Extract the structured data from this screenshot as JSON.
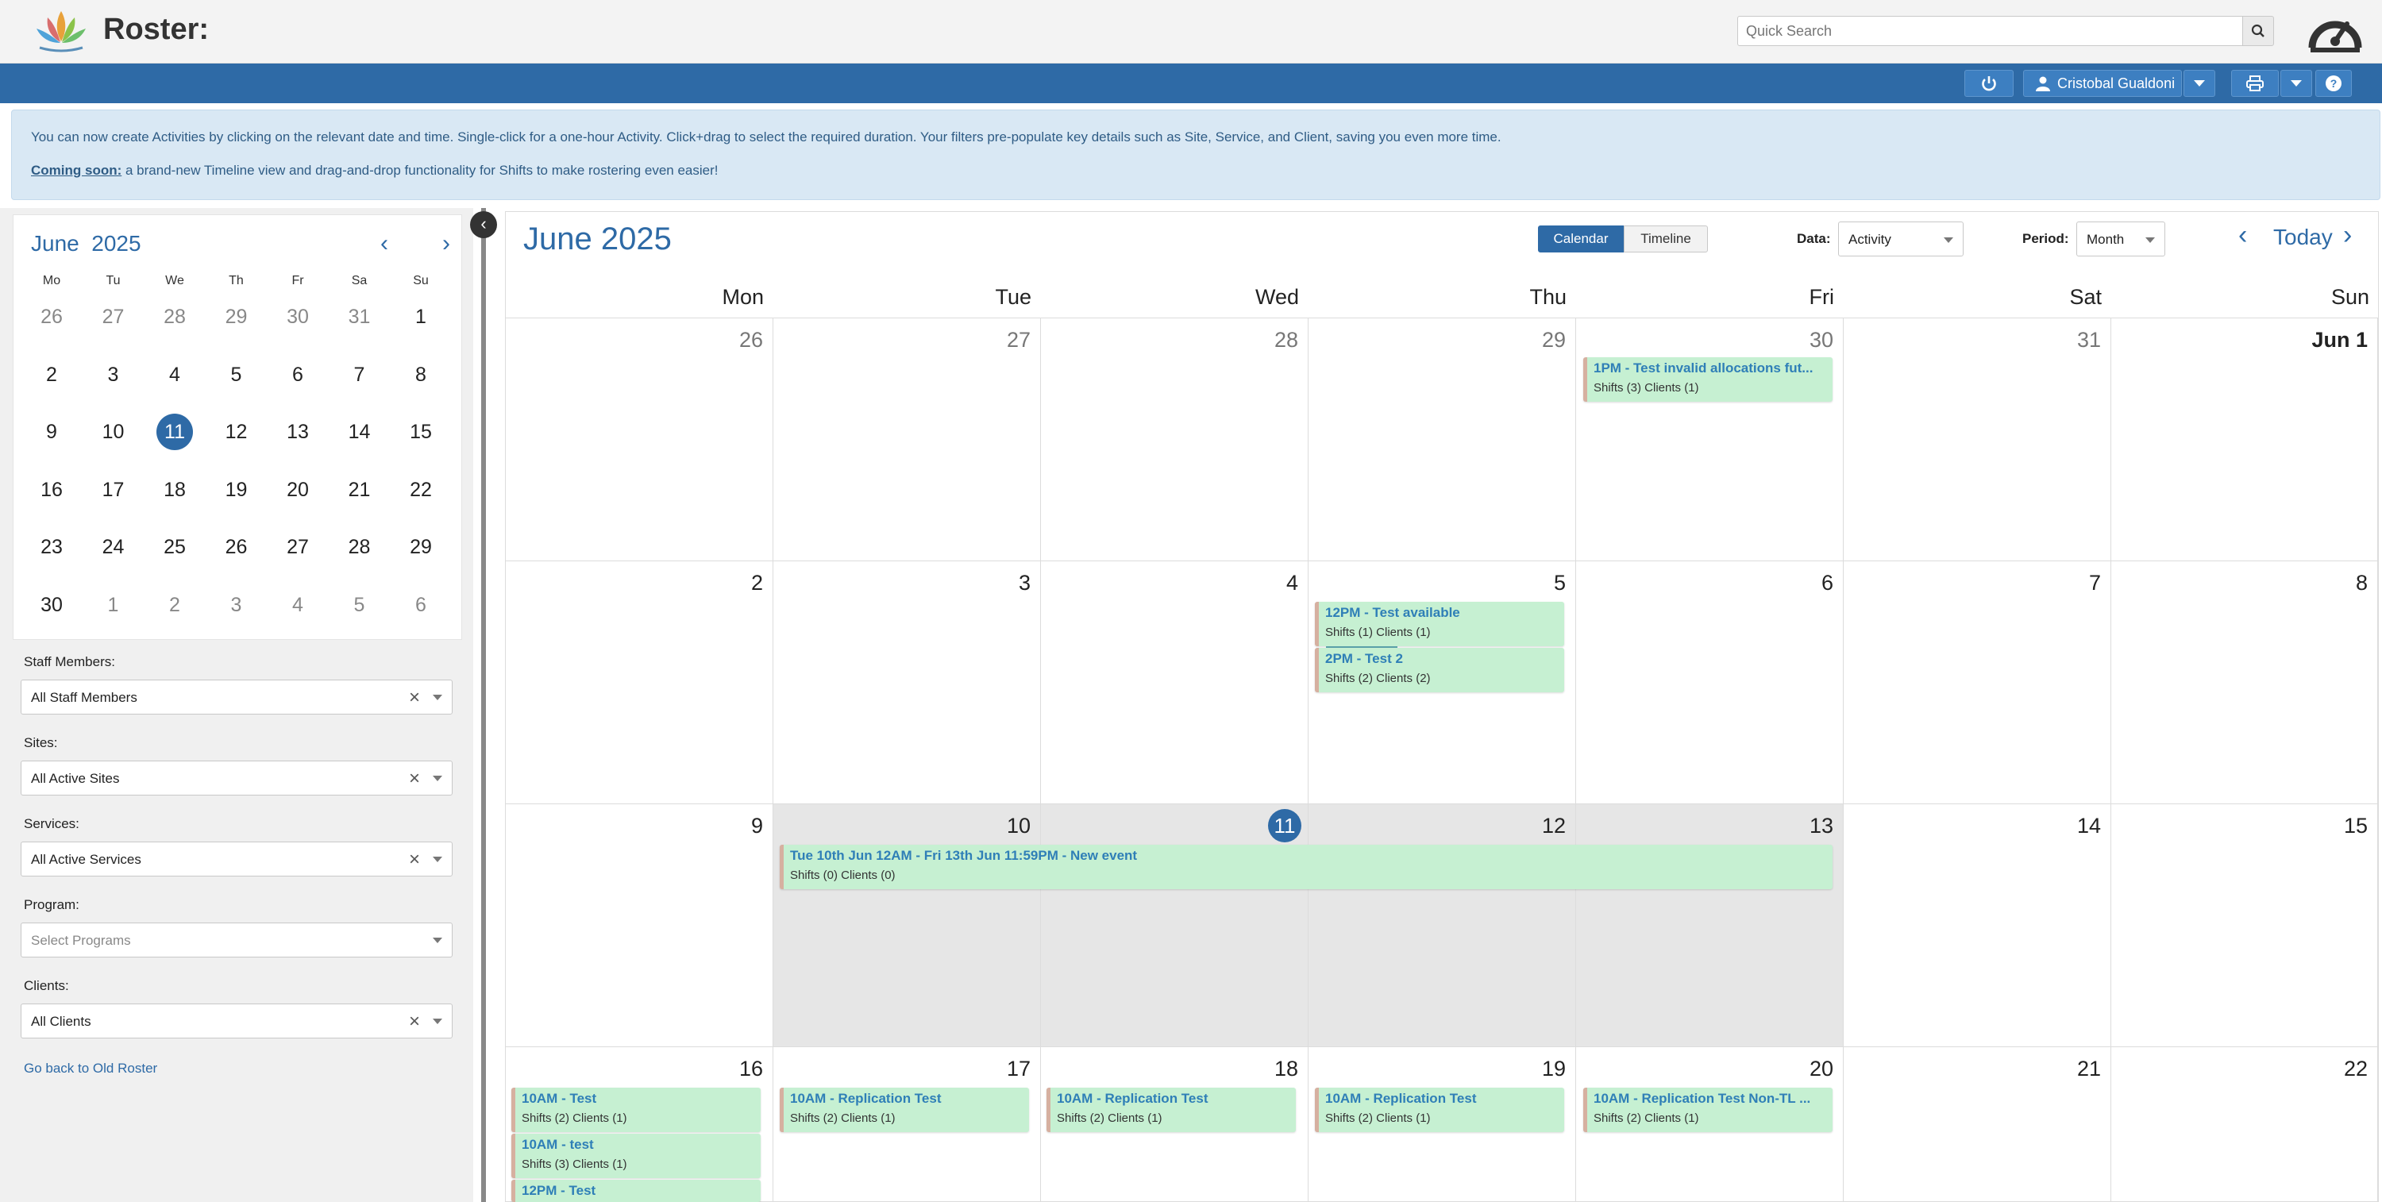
{
  "header": {
    "app_title": "Roster:",
    "search_placeholder": "Quick Search",
    "logo_icon": "lotus-logo-icon",
    "dashboard_icon": "gauge-icon"
  },
  "toolbar": {
    "user_name": "Cristobal Gualdoni",
    "power_icon": "power-icon",
    "print_icon": "printer-icon",
    "help_icon": "help-icon"
  },
  "banner": {
    "line1": "You can now create Activities by clicking on the relevant date and time. Single-click for a one-hour Activity. Click+drag to select the required duration. Your filters pre-populate key details such as Site, Service, and Client, saving you even more time.",
    "coming_soon_label": "Coming soon:",
    "line2": "a brand-new Timeline view and drag-and-drop functionality for Shifts to make rostering even easier!"
  },
  "mini_calendar": {
    "month_label": "June",
    "year_label": "2025",
    "weekdays": [
      "Mo",
      "Tu",
      "We",
      "Th",
      "Fr",
      "Sa",
      "Su"
    ],
    "weeks": [
      [
        "26",
        "27",
        "28",
        "29",
        "30",
        "31",
        "1"
      ],
      [
        "2",
        "3",
        "4",
        "5",
        "6",
        "7",
        "8"
      ],
      [
        "9",
        "10",
        "11",
        "12",
        "13",
        "14",
        "15"
      ],
      [
        "16",
        "17",
        "18",
        "19",
        "20",
        "21",
        "22"
      ],
      [
        "23",
        "24",
        "25",
        "26",
        "27",
        "28",
        "29"
      ],
      [
        "30",
        "1",
        "2",
        "3",
        "4",
        "5",
        "6"
      ]
    ],
    "selected_day": "11"
  },
  "filters": {
    "staff_label": "Staff Members:",
    "staff_value": "All Staff Members",
    "sites_label": "Sites:",
    "sites_value": "All Active Sites",
    "services_label": "Services:",
    "services_value": "All Active Services",
    "program_label": "Program:",
    "program_placeholder": "Select Programs",
    "clients_label": "Clients:",
    "clients_value": "All Clients",
    "back_link": "Go back to Old Roster"
  },
  "main": {
    "title": "June 2025",
    "view_calendar": "Calendar",
    "view_timeline": "Timeline",
    "data_label": "Data:",
    "data_value": "Activity",
    "period_label": "Period:",
    "period_value": "Month",
    "today_label": "Today",
    "weekdays": [
      "Mon",
      "Tue",
      "Wed",
      "Thu",
      "Fri",
      "Sat",
      "Sun"
    ],
    "weeks": [
      [
        "26",
        "27",
        "28",
        "29",
        "30",
        "31",
        "Jun  1"
      ],
      [
        "2",
        "3",
        "4",
        "5",
        "6",
        "7",
        "8"
      ],
      [
        "9",
        "10",
        "11",
        "12",
        "13",
        "14",
        "15"
      ],
      [
        "16",
        "17",
        "18",
        "19",
        "20",
        "21",
        "22"
      ]
    ],
    "today": "11"
  },
  "events": [
    {
      "title": "1PM - Test invalid allocations fut...",
      "sub": "Shifts (3)  Clients (1)"
    },
    {
      "title": "12PM - Test available",
      "sub": "Shifts (1)  Clients (1)"
    },
    {
      "title": "2PM - Test 2",
      "sub": "Shifts (2)  Clients (2)"
    },
    {
      "title": "Tue 10th Jun 12AM - Fri 13th Jun 11:59PM - New event",
      "sub": "Shifts (0)  Clients (0)"
    },
    {
      "title": "10AM - Test",
      "sub": "Shifts (2)  Clients (1)"
    },
    {
      "title": "10AM - test",
      "sub": "Shifts (3)  Clients (1)"
    },
    {
      "title": "12PM - Test",
      "sub": ""
    },
    {
      "title": "10AM - Replication Test",
      "sub": "Shifts (2)  Clients (1)"
    },
    {
      "title": "10AM - Replication Test",
      "sub": "Shifts (2)  Clients (1)"
    },
    {
      "title": "10AM - Replication Test",
      "sub": "Shifts (2)  Clients (1)"
    },
    {
      "title": "10AM - Replication Test Non-TL ...",
      "sub": "Shifts (2)  Clients (1)"
    }
  ]
}
